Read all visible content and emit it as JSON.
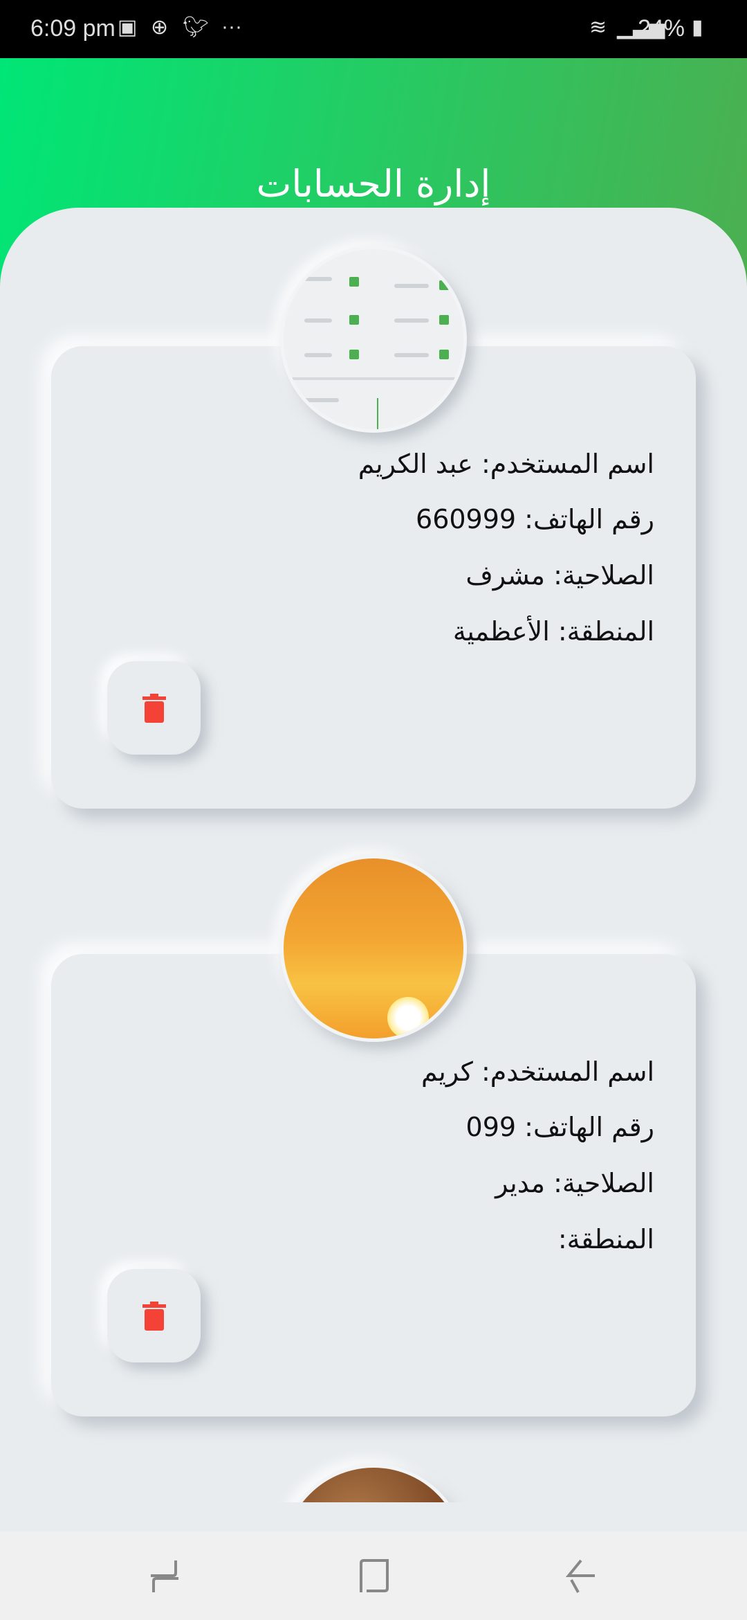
{
  "status_bar": {
    "time": "6:09 pm",
    "battery": "24%",
    "icons": [
      "image-icon",
      "messenger-plus-icon",
      "twitter-icon",
      "more-dots-icon",
      "wifi-icon",
      "signal-icon",
      "battery-charging-icon"
    ]
  },
  "header": {
    "title": "إدارة الحسابات",
    "gradient": [
      "#00e676",
      "#4caf50"
    ]
  },
  "accounts": [
    {
      "username_label": "اسم المستخدم: عبد الكريم",
      "phone_label": "رقم الهاتف: 660999",
      "role_label": "الصلاحية: مشرف",
      "region_label": "المنطقة: الأعظمية",
      "avatar": "screenshot-image"
    },
    {
      "username_label": "اسم المستخدم: كريم",
      "phone_label": "رقم الهاتف: 099",
      "role_label": "الصلاحية: مدير",
      "region_label": "المنطقة:",
      "avatar": "sunset-image"
    }
  ],
  "delete_color": "#f44336",
  "nav": {
    "icons": [
      "recent-apps-icon",
      "home-icon",
      "back-icon"
    ]
  }
}
